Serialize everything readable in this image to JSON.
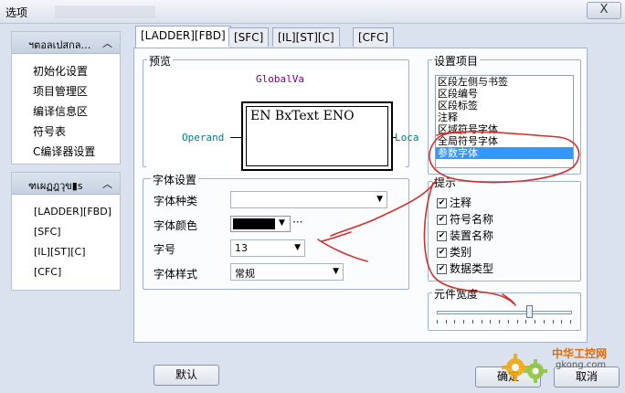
{
  "window": {
    "title": "选项",
    "close_label": "X"
  },
  "sidebar1": {
    "header": "ฯตอลเปสกล…",
    "items": [
      "初始化设置",
      "项目管理区",
      "编译信息区",
      "符号表",
      "C编译器设置"
    ]
  },
  "sidebar2": {
    "header": "ฑเผฏฎวุข▮s",
    "items": [
      "[LADDER][FBD]",
      "[SFC]",
      "[IL][ST][C]",
      "[CFC]"
    ]
  },
  "tabs": [
    "[LADDER][FBD]",
    "[SFC]",
    "[IL][ST][C]",
    "[CFC]"
  ],
  "preview": {
    "legend": "预览",
    "global_var": "GlobalVa",
    "block_text": "EN BxText ENO",
    "operand": "Operand",
    "local": "Loca"
  },
  "font": {
    "legend": "字体设置",
    "type_label": "字体种类",
    "type_value": "",
    "color_label": "字体颜色",
    "color_value": "#000000",
    "color_more": "···",
    "size_label": "字号",
    "size_value": "13",
    "style_label": "字体样式",
    "style_value": "常规"
  },
  "settings": {
    "legend": "设置项目",
    "items": [
      "区段左侧与书签",
      "区段编号",
      "区段标签",
      "注释",
      "区域符号字体",
      "全局符号字体",
      "参数字体"
    ],
    "selected_index": 6
  },
  "hints": {
    "legend": "提示",
    "items": [
      {
        "label": "注释",
        "checked": true
      },
      {
        "label": "符号名称",
        "checked": true
      },
      {
        "label": "装置名称",
        "checked": true
      },
      {
        "label": "类别",
        "checked": true
      },
      {
        "label": "数据类型",
        "checked": true
      }
    ]
  },
  "width": {
    "legend": "元件宽度",
    "slider_value": 0.68,
    "tick_count": 16
  },
  "buttons": {
    "default": "默认",
    "ok": "确定",
    "cancel": "取消"
  },
  "watermark": {
    "brand": "中华工控网",
    "domain": "gkong.com"
  },
  "colors": {
    "accent_select": "#3399ff",
    "annotation": "#d0312d"
  }
}
